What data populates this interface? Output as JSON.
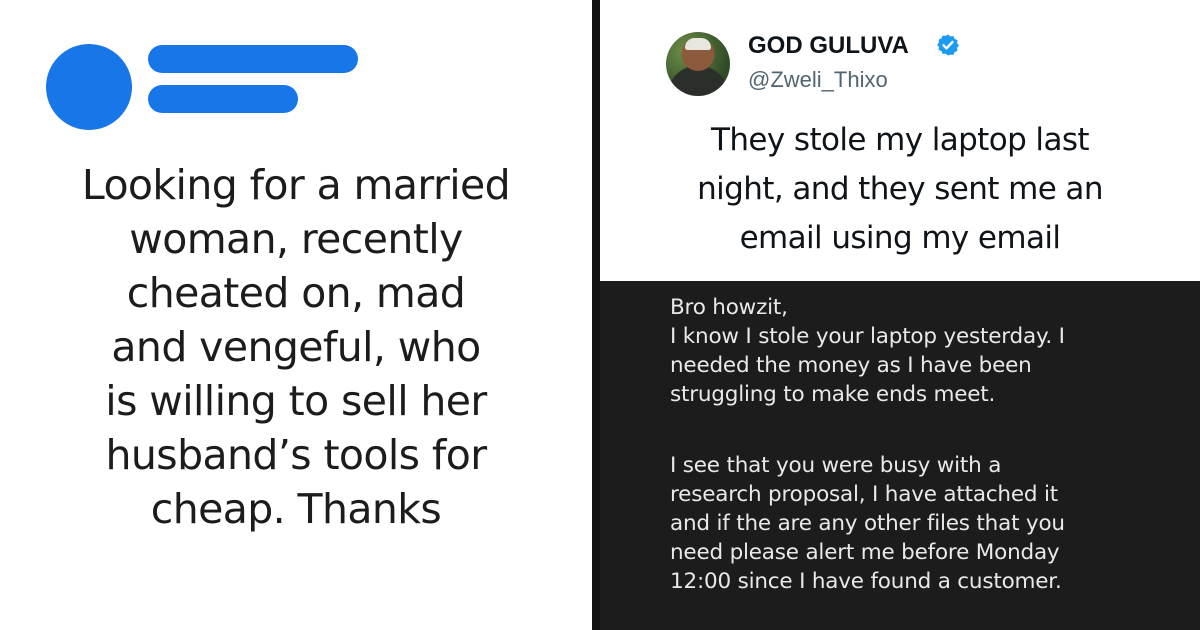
{
  "colors": {
    "accent": "#1877e8",
    "verified": "#1d9bf0",
    "email_bg": "#1c1c1c"
  },
  "left_post": {
    "logo_icon": "speech-bubble-logo-icon",
    "text": "Looking for a married\nwoman, recently\ncheated on, mad\nand vengeful, who\nis willing to sell her\nhusband’s tools for\ncheap. Thanks"
  },
  "tweet": {
    "avatar_icon": "user-avatar",
    "display_name": "GOD GULUVA",
    "verified_icon": "verified-badge-icon",
    "handle": "@Zweli_Thixo",
    "text": "They stole my laptop last\nnight, and they sent me an\nemail using my email"
  },
  "email": {
    "paragraph_1": "Bro howzit,\nI know I stole your laptop yesterday. I\nneeded the money as I have been\nstruggling to make ends meet.",
    "paragraph_2": "I see that you were busy with a\nresearch proposal, I have attached it\nand if the are any other files that you\nneed please alert me before Monday\n12:00 since I have found a customer."
  }
}
